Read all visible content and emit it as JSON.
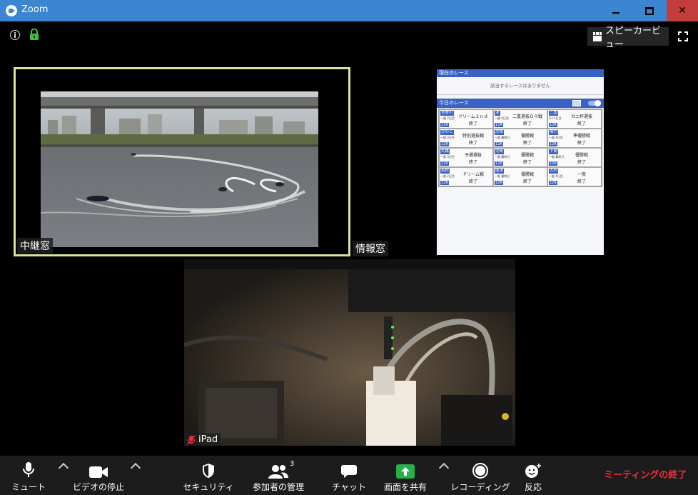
{
  "window": {
    "title": "Zoom"
  },
  "topbar": {
    "speaker_view_label": "スピーカービュー"
  },
  "tiles": {
    "relay_name": "中継窓",
    "info_name": "情報窓",
    "ipad_name": "iPad"
  },
  "info_panel": {
    "current_header": "現在のレース",
    "current_message": "該当するレースはありません",
    "today_header": "今日のレース",
    "races": [
      {
        "venue": "多摩川",
        "grade": "一般 2日目",
        "rno": "12R",
        "name": "ドリーム２ｎｄ",
        "status": "終了"
      },
      {
        "venue": "津",
        "grade": "一般 4日目",
        "rno": "12R",
        "name": "二重選抜ＤＲ戦",
        "status": "終了"
      },
      {
        "venue": "三国",
        "grade": "G3 4日目",
        "rno": "12R",
        "name": "カニ杯選抜",
        "status": "終了"
      },
      {
        "venue": "びわこ",
        "grade": "一般 3日目",
        "rno": "12R",
        "name": "特別選抜戦",
        "status": "終了"
      },
      {
        "venue": "尼崎",
        "grade": "一般 最終日",
        "rno": "12R",
        "name": "優勝戦",
        "status": "終了"
      },
      {
        "venue": "鳴門",
        "grade": "一般 4日目",
        "rno": "12R",
        "name": "準優勝戦",
        "status": "終了"
      },
      {
        "venue": "丸亀",
        "grade": "一般 3日目",
        "rno": "12R",
        "name": "予選選抜",
        "status": "終了"
      },
      {
        "venue": "児島",
        "grade": "一般 最終日",
        "rno": "12R",
        "name": "優勝戦",
        "status": "終了"
      },
      {
        "venue": "下関",
        "grade": "一般 最終日",
        "rno": "12R",
        "name": "優勝戦",
        "status": "終了"
      },
      {
        "venue": "若松",
        "grade": "一般 2日目",
        "rno": "12R",
        "name": "ドリーム戦",
        "status": "終了"
      },
      {
        "venue": "唐津",
        "grade": "一般 最終日",
        "rno": "12R",
        "name": "優勝戦",
        "status": "終了"
      },
      {
        "venue": "大村",
        "grade": "一般 4日目",
        "rno": "12R",
        "name": "一般",
        "status": "終了"
      }
    ]
  },
  "toolbar": {
    "mute": "ミュート",
    "stop_video": "ビデオの停止",
    "security": "セキュリティ",
    "participants": "参加者の管理",
    "participants_count": "3",
    "chat": "チャット",
    "share_screen": "画面を共有",
    "recording": "レコーディング",
    "reactions": "反応",
    "end_meeting": "ミーティングの終了"
  }
}
